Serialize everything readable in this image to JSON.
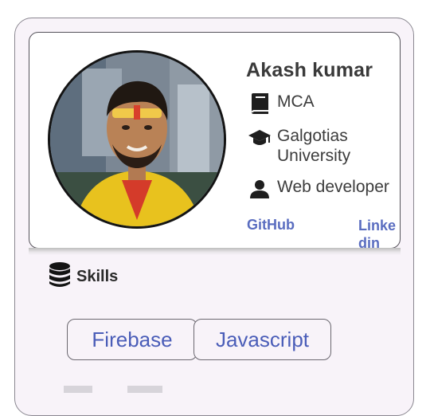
{
  "profile": {
    "name": "Akash kumar",
    "education": "MCA",
    "university": "Galgotias University",
    "role": "Web developer",
    "links": {
      "github": "GitHub",
      "linkedin": "Linkedin"
    }
  },
  "skills": {
    "heading": "Skills",
    "items": [
      "Firebase",
      "Javascript"
    ]
  },
  "icons": {
    "education": "book-icon",
    "university": "graduation-cap-icon",
    "role": "person-icon",
    "skills": "database-icon"
  },
  "colors": {
    "link": "#5a6dc0",
    "chip_text": "#4a5db8",
    "name": "#3a3a3a"
  }
}
